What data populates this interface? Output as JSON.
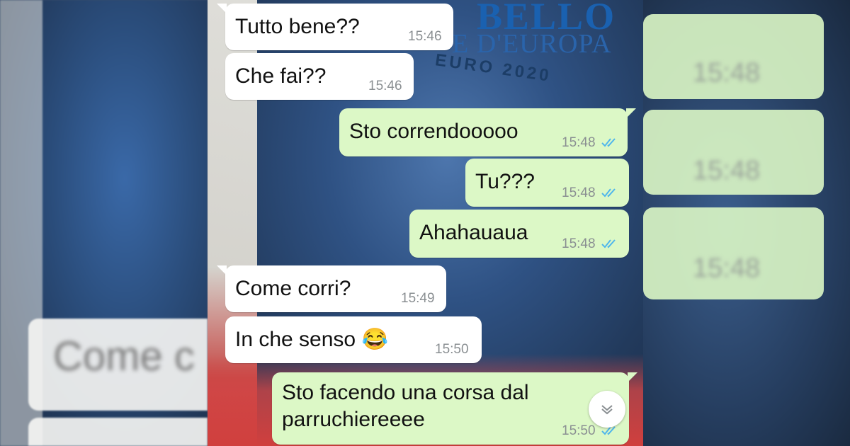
{
  "messages": [
    {
      "dir": "in",
      "text": "Tutto bene??",
      "time": "15:46"
    },
    {
      "dir": "in",
      "text": "Che fai??",
      "time": "15:46"
    },
    {
      "dir": "out",
      "text": "Sto correndooooo",
      "time": "15:48"
    },
    {
      "dir": "out",
      "text": "Tu???",
      "time": "15:48"
    },
    {
      "dir": "out",
      "text": "Ahahauaua",
      "time": "15:48"
    },
    {
      "dir": "in",
      "text": "Come corri?",
      "time": "15:49"
    },
    {
      "dir": "in",
      "text": "In che senso 😂",
      "time": "15:50"
    },
    {
      "dir": "out",
      "text": "Sto facendo una corsa dal parruchiereeee",
      "time": "15:50"
    }
  ],
  "background": {
    "headline": "BELLO",
    "subhead": "E D'EUROPA",
    "arc": "EURO 2020"
  },
  "blurred": {
    "left_text": "Come c",
    "right_time": "15:48"
  },
  "icons": {
    "read_receipt": "double-check-icon",
    "scroll_down": "chevron-down-icon"
  },
  "colors": {
    "incoming_bubble": "#ffffff",
    "outgoing_bubble": "#dcf8c6",
    "read_tick": "#4fb6ec"
  }
}
